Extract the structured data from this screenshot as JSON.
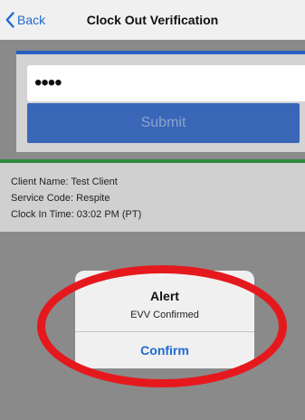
{
  "nav": {
    "back_label": "Back",
    "title": "Clock Out Verification"
  },
  "pin": {
    "value": "••••"
  },
  "submit": {
    "label": "Submit"
  },
  "info": {
    "client_name": "Client Name: Test Client",
    "service_code": "Service Code: Respite",
    "clock_in_time": "Clock In Time: 03:02 PM (PT)"
  },
  "alert": {
    "title": "Alert",
    "message": "EVV Confirmed",
    "confirm_label": "Confirm"
  },
  "colors": {
    "accent": "#1f6ad1",
    "submit_bg": "#3a66b8",
    "green_bar": "#2f8a3c",
    "annotation": "#e5191d"
  },
  "icons": {
    "back": "chevron-left-icon"
  }
}
